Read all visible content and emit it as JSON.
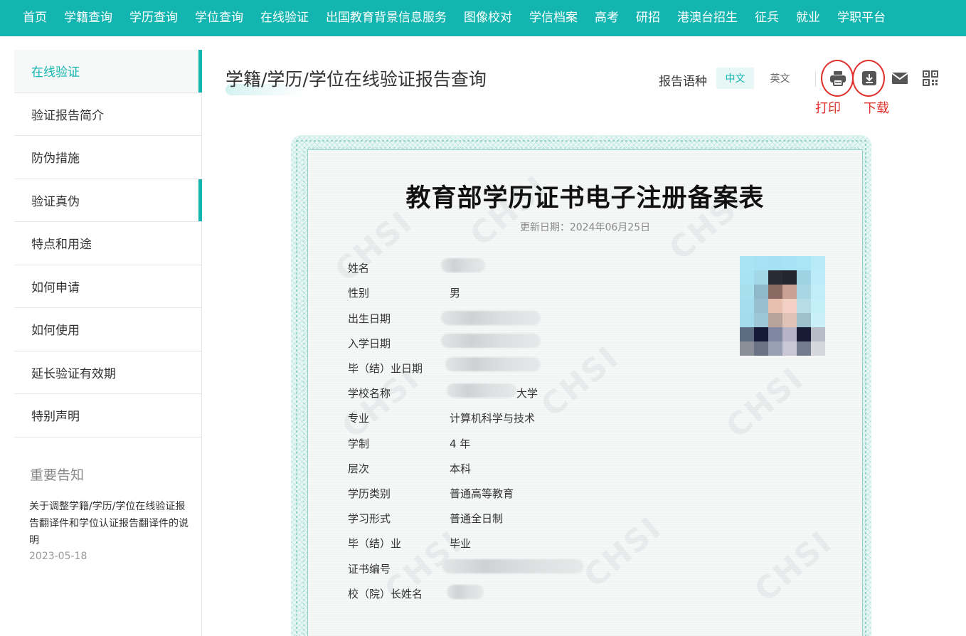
{
  "nav": {
    "items": [
      "首页",
      "学籍查询",
      "学历查询",
      "学位查询",
      "在线验证",
      "出国教育背景信息服务",
      "图像校对",
      "学信档案",
      "高考",
      "研招",
      "港澳台招生",
      "征兵",
      "就业",
      "学职平台"
    ]
  },
  "sidebar": {
    "items": [
      {
        "label": "在线验证"
      },
      {
        "label": "验证报告简介"
      },
      {
        "label": "防伪措施"
      },
      {
        "label": "验证真伪"
      },
      {
        "label": "特点和用途"
      },
      {
        "label": "如何申请"
      },
      {
        "label": "如何使用"
      },
      {
        "label": "延长验证有效期"
      },
      {
        "label": "特别声明"
      }
    ],
    "notice_title": "重要告知",
    "notice_text": "关于调整学籍/学历/学位在线验证报告翻译件和学位认证报告翻译件的说明",
    "notice_date": "2023-05-18"
  },
  "header": {
    "title": "学籍/学历/学位在线验证报告查询",
    "lang_label": "报告语种",
    "lang_zh": "中文",
    "lang_en": "英文",
    "print_label": "打印",
    "download_label": "下载"
  },
  "icons": {
    "print": "printer-icon",
    "download": "download-icon",
    "mail": "mail-icon",
    "qr": "qr-code-icon"
  },
  "colors": {
    "accent": "#13b5b1",
    "annotation": "#e0302c"
  },
  "certificate": {
    "title": "教育部学历证书电子注册备案表",
    "updated": "更新日期：2024年06月25日",
    "watermark": "CHSI",
    "fields": [
      {
        "label": "姓名",
        "value": ""
      },
      {
        "label": "性别",
        "value": "男"
      },
      {
        "label": "出生日期",
        "value": ""
      },
      {
        "label": "入学日期",
        "value": ""
      },
      {
        "label": "毕（结）业日期",
        "value": ""
      },
      {
        "label": "学校名称",
        "value": "大学"
      },
      {
        "label": "专业",
        "value": "计算机科学与技术"
      },
      {
        "label": "学制",
        "value": "4 年"
      },
      {
        "label": "层次",
        "value": "本科"
      },
      {
        "label": "学历类别",
        "value": "普通高等教育"
      },
      {
        "label": "学习形式",
        "value": "普通全日制"
      },
      {
        "label": "毕（结）业",
        "value": "毕业"
      },
      {
        "label": "证书编号",
        "value": ""
      },
      {
        "label": "校（院）长姓名",
        "value": ""
      }
    ]
  }
}
